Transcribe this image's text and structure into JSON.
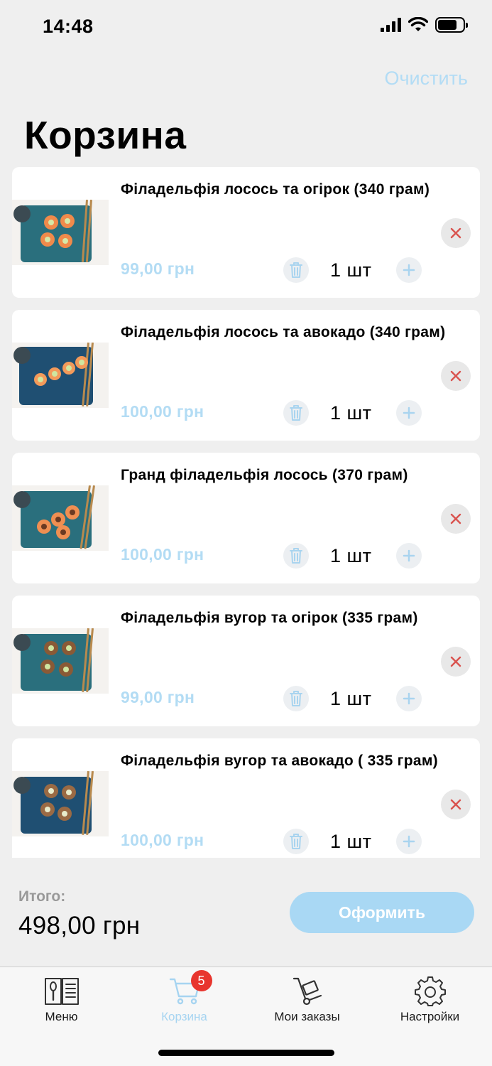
{
  "status_bar": {
    "time": "14:48"
  },
  "header": {
    "clear_label": "Очистить",
    "title": "Корзина"
  },
  "cart": {
    "items": [
      {
        "name": "Філадельфія лосось та огірок (340 грам)",
        "price": "99,00 грн",
        "quantity": "1 шт"
      },
      {
        "name": "Філадельфія лосось та авокадо (340 грам)",
        "price": "100,00 грн",
        "quantity": "1 шт"
      },
      {
        "name": "Гранд філадельфія лосось (370 грам)",
        "price": "100,00 грн",
        "quantity": "1 шт"
      },
      {
        "name": "Філадельфія вугор та огірок (335 грам)",
        "price": "99,00 грн",
        "quantity": "1 шт"
      },
      {
        "name": "Філадельфія вугор та авокадо ( 335 грам)",
        "price": "100,00 грн",
        "quantity": "1 шт"
      }
    ]
  },
  "summary": {
    "total_label": "Итого:",
    "total_value": "498,00 грн",
    "checkout_label": "Оформить"
  },
  "tab_bar": {
    "tabs": [
      {
        "label": "Меню",
        "icon": "menu-book-icon"
      },
      {
        "label": "Корзина",
        "icon": "cart-icon",
        "badge": "5",
        "active": true
      },
      {
        "label": "Мои заказы",
        "icon": "hand-truck-icon"
      },
      {
        "label": "Настройки",
        "icon": "gear-icon"
      }
    ]
  },
  "colors": {
    "accent": "#a9d8f4",
    "price": "#b3dcf4",
    "badge": "#e8352e",
    "remove": "#d9534f",
    "background": "#efefef"
  }
}
